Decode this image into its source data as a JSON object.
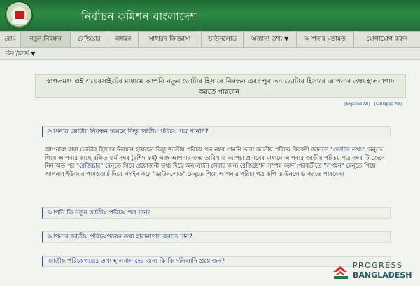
{
  "header": {
    "title": "নির্বাচন কমিশন বাংলাদেশ",
    "emblem": "election-commission-emblem"
  },
  "nav": {
    "items": [
      {
        "label": "হোম"
      },
      {
        "label": "নতুন নিবন্ধন"
      },
      {
        "label": "রেজিষ্টার"
      },
      {
        "label": "লগইন"
      },
      {
        "label": "সাধারন জিজ্ঞাসা"
      },
      {
        "label": "ডাউনলোড"
      },
      {
        "label": "অন্যান্য তথ্য",
        "dropdown": true
      },
      {
        "label": "আপনার মতামত"
      },
      {
        "label": "যোগাযোগ করুন"
      }
    ],
    "second_row": {
      "label": "ফিস/চার্জ",
      "dropdown": true
    }
  },
  "welcome": {
    "text": "স্বাগতম!! এই ওয়েবসাইটের মাধ্যমে আপনি নতুন ভোটার হিসাবে নিবন্ধন এবং পুরাতন ভোটার হিসাবে আপনার তথ্য হালনাগাদ করতে পারবেন।"
  },
  "accordion_controls": {
    "expand_all": "Expand All",
    "separator": "|",
    "collapse_all": "Collapse All"
  },
  "faq": {
    "q1": "আপনার ভোটার নিবন্ধন হয়েছে কিন্তু জাতীয় পরিচয় পত্র পাননি?",
    "a1_part1": "আপনারা যারা ভোটার হিসাবে নিবন্ধন হয়েছেন কিন্তু জাতীয় পরিচয় পত্র নম্বর পাননি তারা জাতীয় পরিচয় বিবরণী জানতে ",
    "a1_link1": "\"ভোটার তথ্য\"",
    "a1_part2": " মেনুতে গিয়ে আপনার কাছে রক্ষিত ফর্ম নম্বর (রশিদ ফর্ম) এবং আপনার জন্ম তারিখ ও ক্যাপচা প্রদানের মাধ্যমে আপনার জাতীয় পরিচয় পত্র নম্বর টি জেনে নিন অত:পর ",
    "a1_link2": "\"রেজিষ্টার\"",
    "a1_part3": " মেনুতে গিয়ে প্রয়োজনী তথ্য দিয়ে অন-লাইন সেবার জন্য রেজিষ্টেশন সম্পন্ন করুন।পরবর্তীতে ",
    "a1_link3": "\"লগইন\"",
    "a1_part4": " মেনুতে গিয়ে আপনার ইউজার পাসওয়ার্ড দিয়ে লগইন করে \"ডাউনলোড\" মেনুতে গিয়ে আপনার পরিচয়পত্র কপি ডাউনলোড করতে পারবেন।",
    "q2": "আপনি কি নতুন জাতীয় পরিচয় পত্র চান?",
    "q3": "আপনার জাতীয় পরিচয়পত্রের তথ্য হালনাগাদ করতে চান?",
    "q4": "জাতীয় পরিচয়পত্রের তথ্য হালনাগাদের জন্য কি কি দলিলাদি প্রয়োজন?"
  },
  "watermark": {
    "line1": "PROGRESS",
    "line2": "BANGLADESH"
  },
  "colors": {
    "header_green": "#2f8a45",
    "link_blue": "#1b2f8a",
    "logo_red": "#d12b2b",
    "logo_green": "#1f7a3a"
  }
}
